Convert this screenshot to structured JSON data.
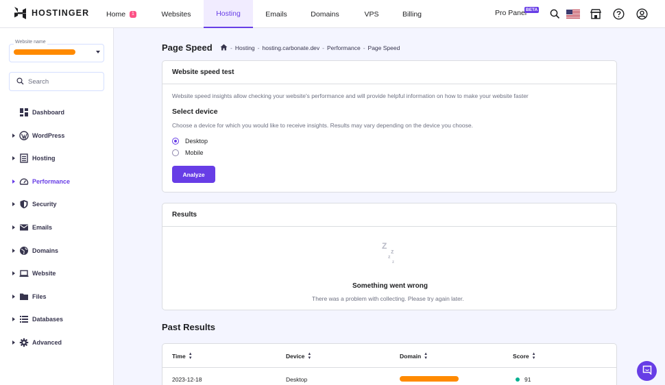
{
  "brand": {
    "name": "HOSTINGER"
  },
  "nav": {
    "items": [
      {
        "label": "Home",
        "badge": "1"
      },
      {
        "label": "Websites"
      },
      {
        "label": "Hosting",
        "active": true
      },
      {
        "label": "Emails"
      },
      {
        "label": "Domains"
      },
      {
        "label": "VPS"
      },
      {
        "label": "Billing"
      }
    ],
    "pro_panel": "Pro Panel",
    "beta": "BETA"
  },
  "sidebar": {
    "website_name_label": "Website name",
    "search_placeholder": "Search",
    "items": [
      {
        "label": "Dashboard",
        "icon": "dashboard-icon",
        "arrow": false
      },
      {
        "label": "WordPress",
        "icon": "wordpress-icon",
        "arrow": true
      },
      {
        "label": "Hosting",
        "icon": "hosting-icon",
        "arrow": true
      },
      {
        "label": "Performance",
        "icon": "speedometer-icon",
        "arrow": true,
        "active": true
      },
      {
        "label": "Security",
        "icon": "shield-icon",
        "arrow": true
      },
      {
        "label": "Emails",
        "icon": "envelope-icon",
        "arrow": true
      },
      {
        "label": "Domains",
        "icon": "globe-icon",
        "arrow": true
      },
      {
        "label": "Website",
        "icon": "laptop-icon",
        "arrow": true
      },
      {
        "label": "Files",
        "icon": "folder-icon",
        "arrow": true
      },
      {
        "label": "Databases",
        "icon": "database-icon",
        "arrow": true
      },
      {
        "label": "Advanced",
        "icon": "gear-icon",
        "arrow": true
      }
    ]
  },
  "page": {
    "title": "Page Speed",
    "breadcrumb": [
      "Hosting",
      "hosting.carbonate.dev",
      "Performance",
      "Page Speed"
    ]
  },
  "speed_test": {
    "title": "Website speed test",
    "description": "Website speed insights allow checking your website's performance and will provide helpful information on how to make your website faster",
    "select_device_title": "Select device",
    "select_device_desc": "Choose a device for which you would like to receive insights. Results may vary depending on the device you choose.",
    "options": [
      {
        "label": "Desktop",
        "checked": true
      },
      {
        "label": "Mobile",
        "checked": false
      }
    ],
    "analyze_label": "Analyze"
  },
  "results": {
    "title": "Results",
    "empty_icon": "sleeping-zzz-icon",
    "error_title": "Something went wrong",
    "error_desc": "There was a problem with collecting. Please try again later."
  },
  "past_results": {
    "title": "Past Results",
    "columns": [
      "Time",
      "Device",
      "Domain",
      "Score"
    ],
    "rows": [
      {
        "time": "2023-12-18",
        "device": "Desktop",
        "domain": "",
        "score": "91",
        "score_color": "#00b090"
      }
    ]
  },
  "colors": {
    "accent": "#673de6",
    "badge": "#fc5185",
    "success": "#00b090"
  }
}
